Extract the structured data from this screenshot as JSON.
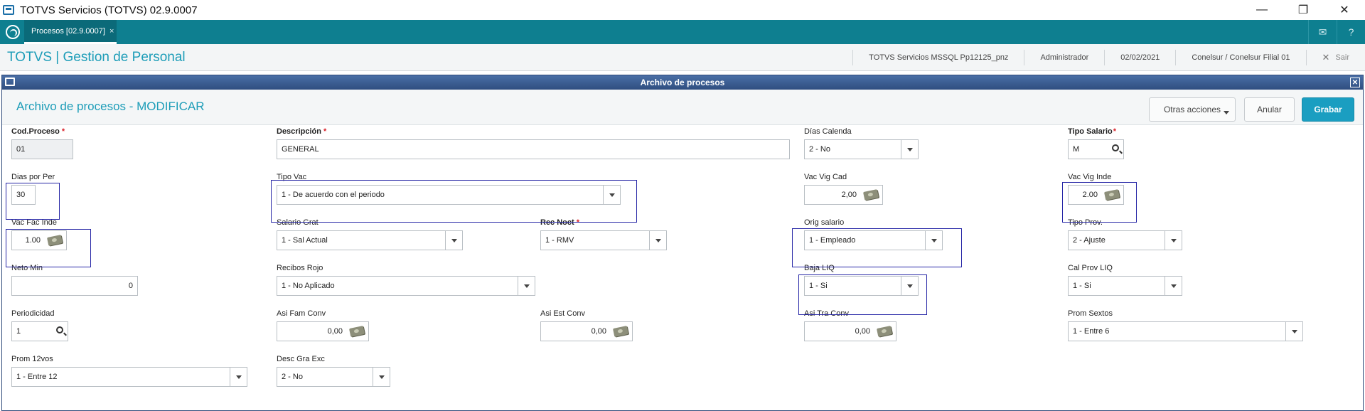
{
  "window": {
    "title": "TOTVS Servicios (TOTVS) 02.9.0007"
  },
  "tabbar": {
    "tab_label": "Procesos [02.9.0007]",
    "tab_close": "×"
  },
  "header": {
    "brand": "TOTVS | Gestion de Personal",
    "environment": "TOTVS Servicios MSSQL Pp12125_pnz",
    "user": "Administrador",
    "date": "02/02/2021",
    "branch": "Conelsur / Conelsur Filial 01",
    "exit_label": "Sair"
  },
  "dialog": {
    "title": "Archivo de procesos",
    "page_title": "Archivo de procesos - MODIFICAR",
    "actions": {
      "otras": "Otras acciones",
      "anular": "Anular",
      "grabar": "Grabar"
    }
  },
  "form": {
    "cod_proceso": {
      "label": "Cod.Proceso",
      "value": "01"
    },
    "descripcion": {
      "label": "Descripción",
      "value": "GENERAL"
    },
    "dias_calenda": {
      "label": "Días Calenda",
      "value": "2 - No"
    },
    "tipo_salario": {
      "label": "Tipo Salario",
      "value": "M"
    },
    "dias_por_per": {
      "label": "Dias por Per",
      "value": "30"
    },
    "tipo_vac": {
      "label": "Tipo Vac",
      "value": "1 - De acuerdo con el periodo"
    },
    "vac_vig_cad": {
      "label": "Vac Vig Cad",
      "value": "2,00"
    },
    "vac_vig_inde": {
      "label": "Vac Vig Inde",
      "value": "2.00"
    },
    "vac_fac_inde": {
      "label": "Vac Fac Inde",
      "value": "1.00"
    },
    "salario_grat": {
      "label": "Salario Grat",
      "value": "1 - Sal Actual"
    },
    "rec_noct": {
      "label": "Rec Noct",
      "value": "1 - RMV"
    },
    "orig_salario": {
      "label": "Orig salario",
      "value": "1 - Empleado"
    },
    "tipo_prov": {
      "label": "Tipo Prov.",
      "value": "2 - Ajuste"
    },
    "neto_min": {
      "label": "Neto Min",
      "value": "0"
    },
    "recibos_rojo": {
      "label": "Recibos Rojo",
      "value": "1 - No Aplicado"
    },
    "baja_liq": {
      "label": "Baja LIQ",
      "value": "1 - Si"
    },
    "cal_prov_liq": {
      "label": "Cal Prov LIQ",
      "value": "1 - Si"
    },
    "periodicidad": {
      "label": "Periodicidad",
      "value": "1"
    },
    "asi_fam_conv": {
      "label": "Asi Fam Conv",
      "value": "0,00"
    },
    "asi_est_conv": {
      "label": "Asi Est Conv",
      "value": "0,00"
    },
    "asi_tra_conv": {
      "label": "Asi Tra Conv",
      "value": "0,00"
    },
    "prom_sextos": {
      "label": "Prom Sextos",
      "value": "1 - Entre 6"
    },
    "prom_12vos": {
      "label": "Prom 12vos",
      "value": "1 - Entre 12"
    },
    "desc_gra_exc": {
      "label": "Desc Gra Exc",
      "value": "2 - No"
    }
  },
  "colors": {
    "teal": "#0e7f90",
    "brand": "#1d9db8",
    "grabar": "#1a9ec1",
    "required": "#d9212a",
    "highlight": "#2626a6"
  }
}
